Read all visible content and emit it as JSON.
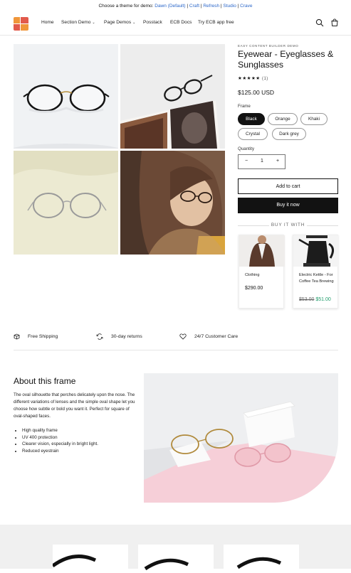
{
  "announcement": {
    "prefix": "Choose a theme for demo: ",
    "themes": [
      "Dawn (Default)",
      "Craft",
      "Refresh",
      "Studio",
      "Crave"
    ],
    "sep": " | "
  },
  "nav": {
    "items": [
      {
        "label": "Home",
        "dropdown": false
      },
      {
        "label": "Section Demo",
        "dropdown": true
      },
      {
        "label": "Page Demos",
        "dropdown": true
      },
      {
        "label": "Posstack",
        "dropdown": false
      },
      {
        "label": "ECB Docs",
        "dropdown": false
      },
      {
        "label": "Try ECB app free",
        "dropdown": false
      }
    ],
    "icons": [
      "search-icon",
      "cart-icon"
    ]
  },
  "product": {
    "vendor": "EASY CONTENT BUILDER DEMO",
    "title_line1": "Eyewear - Eyeglasses &",
    "title_line2": "Sunglasses",
    "stars": "★★★★★",
    "review_count": "(1)",
    "price": "$125.00 USD",
    "frame_label": "Frame",
    "frames": [
      "Black",
      "Orange",
      "Khaki",
      "Crystal",
      "Dark grey"
    ],
    "selected_frame": "Black",
    "quantity_label": "Quantity",
    "quantity": "1",
    "minus": "−",
    "plus": "+",
    "add_to_cart": "Add to cart",
    "buy_now": "Buy it now"
  },
  "buy_with": {
    "heading": "BUY IT WITH",
    "items": [
      {
        "title": "Clothing",
        "price": "$290.00",
        "compare_price": "",
        "sale_price": ""
      },
      {
        "title": "Electric Kettle - For Coffee Tea Brewing",
        "price": "",
        "compare_price": "$53.00",
        "sale_price": "$51.00"
      }
    ]
  },
  "features": [
    {
      "icon": "box-icon",
      "label": "Free Shipping"
    },
    {
      "icon": "return-icon",
      "label": "30-day returns"
    },
    {
      "icon": "heart-icon",
      "label": "24/7 Customer Care"
    }
  ],
  "about": {
    "heading": "About this frame",
    "body": "The oval silhouette that perches delicately upon the nose. The different variations of lenses and the simple oval shape let you choose how subtle or bold you want it. Perfect for square of oval-shaped faces.",
    "bullets": [
      "High quality frame",
      "UV 400 protection",
      "Clearer vision, especially in bright light.",
      "Reduced eyestrain"
    ]
  },
  "colors": {
    "accent_link": "#2a66c9",
    "sale_green": "#1f9c6b",
    "dark": "#121212",
    "pink": "#f4c9d2"
  }
}
